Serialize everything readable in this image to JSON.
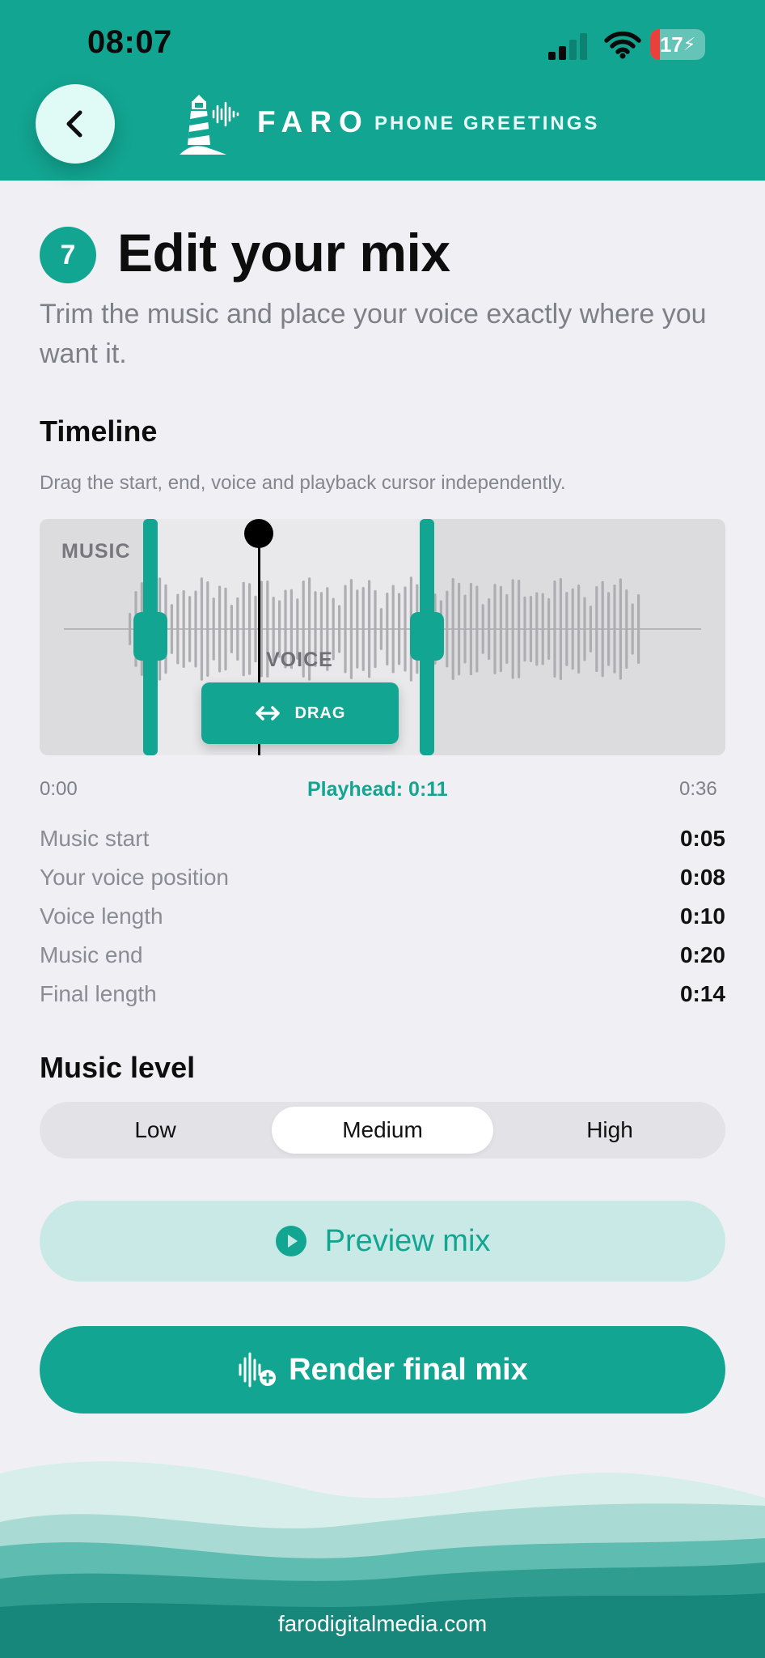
{
  "status_bar": {
    "time": "08:07",
    "battery_percent": 17,
    "battery_label": "17"
  },
  "header": {
    "brand_name": "FARO",
    "brand_tagline": "PHONE GREETINGS"
  },
  "step": {
    "number": "7",
    "title": "Edit your mix",
    "subtitle": "Trim the music and place your voice exactly where you want it."
  },
  "timeline": {
    "heading": "Timeline",
    "helper": "Drag the start, end, voice and playback cursor independently.",
    "music_label": "MUSIC",
    "voice_label": "VOICE",
    "drag_label": "DRAG",
    "time_min": "0:00",
    "time_max": "0:36",
    "playhead_text": "Playhead: 0:11"
  },
  "stats": [
    {
      "label": "Music start",
      "value": "0:05"
    },
    {
      "label": "Your voice position",
      "value": "0:08"
    },
    {
      "label": "Voice length",
      "value": "0:10"
    },
    {
      "label": "Music end",
      "value": "0:20"
    },
    {
      "label": "Final length",
      "value": "0:14"
    }
  ],
  "music_level": {
    "heading": "Music level",
    "options": [
      "Low",
      "Medium",
      "High"
    ],
    "selected": "Medium"
  },
  "buttons": {
    "preview": "Preview mix",
    "render": "Render final mix"
  },
  "footer": {
    "link": "farodigitalmedia.com"
  },
  "colors": {
    "accent": "#12a591",
    "accent_light": "#c9e9e6",
    "battery_low": "#e8413c"
  }
}
